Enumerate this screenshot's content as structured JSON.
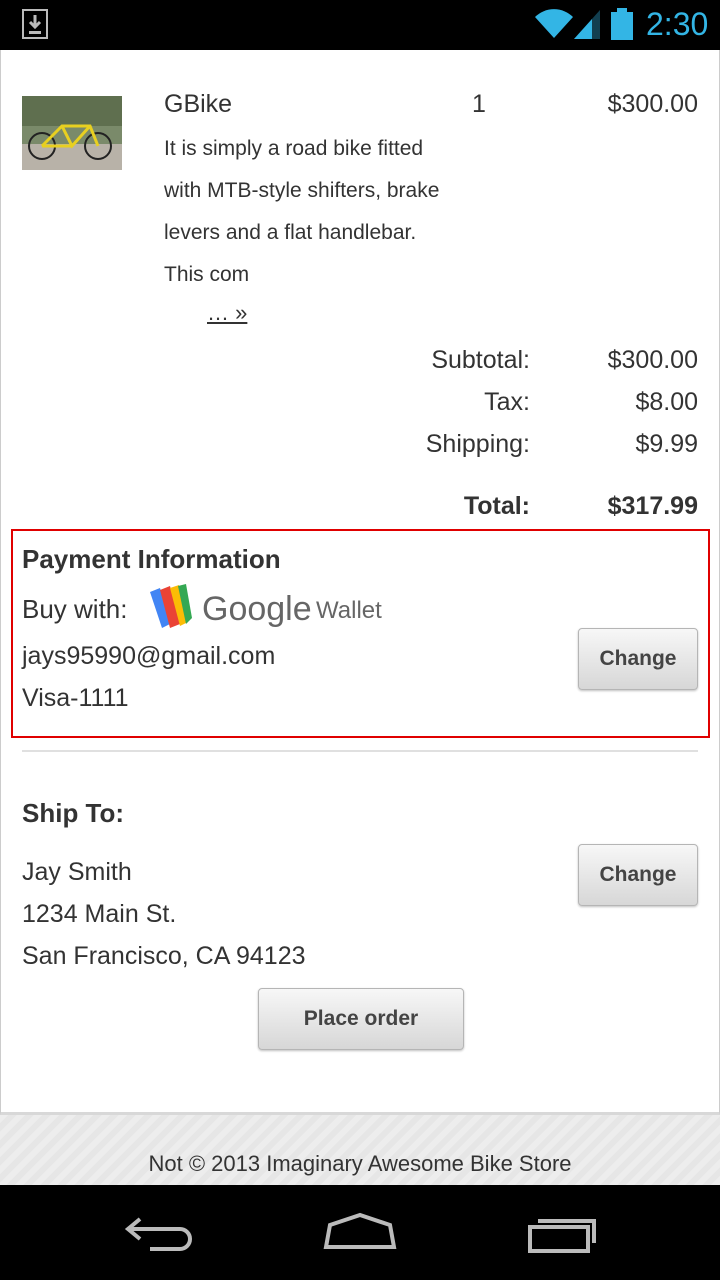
{
  "status_bar": {
    "time": "2:30",
    "icons": [
      "download-icon",
      "wifi-icon",
      "signal-icon",
      "battery-icon"
    ],
    "accent": "#33b5e5"
  },
  "cart": {
    "item": {
      "name": "GBike",
      "quantity": "1",
      "price": "$300.00",
      "description": "It is simply a road bike fitted with MTB-style shifters, brake levers and a flat handlebar. This com",
      "more_link": "… »"
    },
    "summary": {
      "subtotal_label": "Subtotal:",
      "subtotal": "$300.00",
      "tax_label": "Tax:",
      "tax": "$8.00",
      "shipping_label": "Shipping:",
      "shipping": "$9.99",
      "total_label": "Total:",
      "total": "$317.99"
    }
  },
  "payment": {
    "heading": "Payment Information",
    "buy_with": "Buy with:",
    "wallet_brand": "Google",
    "wallet_product": "Wallet",
    "email": "jays95990@gmail.com",
    "card": "Visa-1111",
    "change_label": "Change",
    "highlight_color": "#e00000"
  },
  "shipping": {
    "heading": "Ship To:",
    "name": "Jay Smith",
    "street": "1234 Main St.",
    "city": "San Francisco, CA 94123",
    "change_label": "Change"
  },
  "place_order_label": "Place order",
  "footer": {
    "text": "Not © 2013 Imaginary Awesome Bike Store"
  },
  "nav_bar": {
    "icons": [
      "back-icon",
      "home-icon",
      "recent-apps-icon"
    ]
  }
}
